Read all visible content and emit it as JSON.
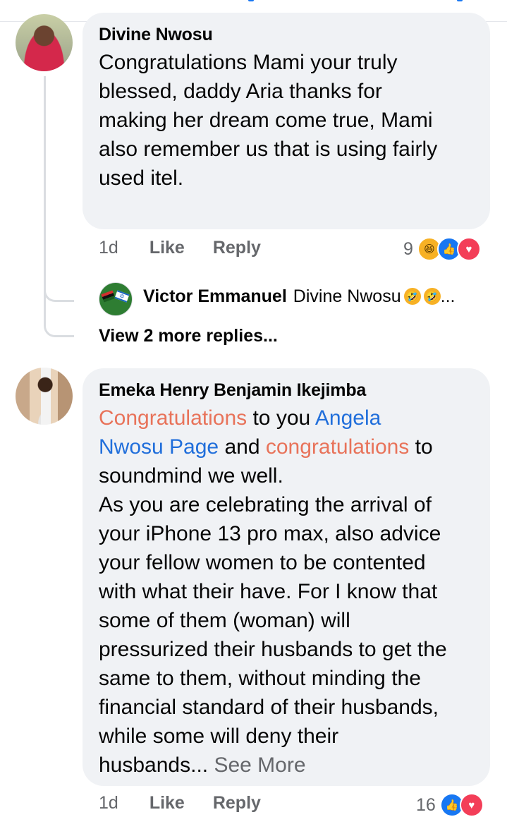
{
  "comments": [
    {
      "author": "Divine Nwosu",
      "text_lines": [
        "Congratulations Mami your truly",
        "blessed, daddy Aria thanks for",
        "making her dream come true, Mami",
        "also remember us that is using fairly",
        "used itel."
      ],
      "time": "1d",
      "like_label": "Like",
      "reply_label": "Reply",
      "reaction_count": "9",
      "reactions": [
        "haha-icon",
        "like-icon",
        "love-icon"
      ],
      "reply_preview": {
        "author": "Victor Emmanuel",
        "text": "Divine Nwosu",
        "emojis": [
          "rolling-laughing-icon",
          "rolling-laughing-icon"
        ],
        "ellipsis": "..."
      },
      "view_more_label": "View 2 more replies..."
    },
    {
      "author": "Emeka Henry Benjamin Ikejimba",
      "line1": {
        "a": "Congratulations",
        "b": " to you ",
        "c": "Angela"
      },
      "line2": {
        "a": "Nwosu Page",
        "b": " and ",
        "c": "congratulations",
        "d": " to"
      },
      "text_lines": [
        "soundmind we well.",
        "As you are celebrating the arrival of",
        "your iPhone 13 pro max, also advice",
        "your fellow women to be contented",
        "with what their have. For I know that",
        "some of them (woman) will",
        "pressurized their husbands to get the",
        "same to them, without minding the",
        "financial standard of their husbands,",
        "while some will deny their"
      ],
      "last_line": "husbands...",
      "see_more": " See More",
      "time": "1d",
      "like_label": "Like",
      "reply_label": "Reply",
      "reaction_count": "16",
      "reactions": [
        "like-icon",
        "love-icon"
      ]
    }
  ],
  "colors": {
    "mention": "#216fdb",
    "highlight": "#e8735a",
    "bubble": "#f0f2f5",
    "meta": "#65676b"
  }
}
